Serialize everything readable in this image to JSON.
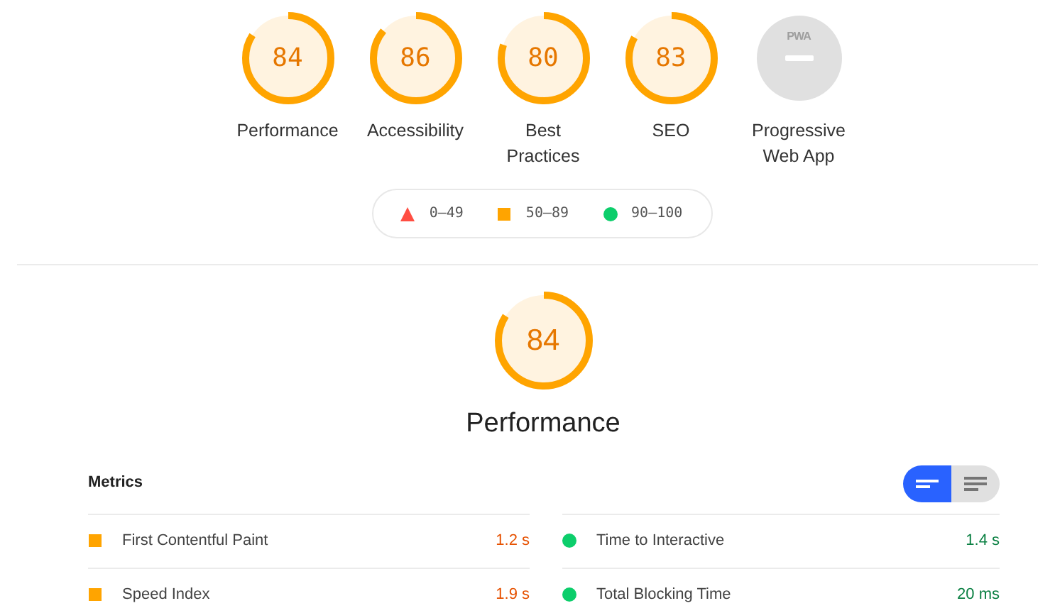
{
  "gauges": [
    {
      "score": "84",
      "label": "Performance",
      "kind": "score"
    },
    {
      "score": "86",
      "label": "Accessibility",
      "kind": "score"
    },
    {
      "score": "80",
      "label": "Best Practices",
      "kind": "score"
    },
    {
      "score": "83",
      "label": "SEO",
      "kind": "score"
    },
    {
      "badge": "PWA",
      "label": "Progressive Web App",
      "kind": "pwa"
    }
  ],
  "legend": [
    {
      "kind": "fail",
      "range": "0–49"
    },
    {
      "kind": "average",
      "range": "50–89"
    },
    {
      "kind": "pass",
      "range": "90–100"
    }
  ],
  "category": {
    "score": "84",
    "title": "Performance"
  },
  "metrics": {
    "title": "Metrics",
    "view_toggle": [
      {
        "kind": "bars",
        "selected": true
      },
      {
        "kind": "list",
        "selected": false
      }
    ],
    "items": [
      {
        "kind": "average",
        "name": "First Contentful Paint",
        "value": "1.2 s"
      },
      {
        "kind": "pass",
        "name": "Time to Interactive",
        "value": "1.4 s"
      },
      {
        "kind": "average",
        "name": "Speed Index",
        "value": "1.9 s"
      },
      {
        "kind": "pass",
        "name": "Total Blocking Time",
        "value": "20 ms"
      }
    ]
  }
}
